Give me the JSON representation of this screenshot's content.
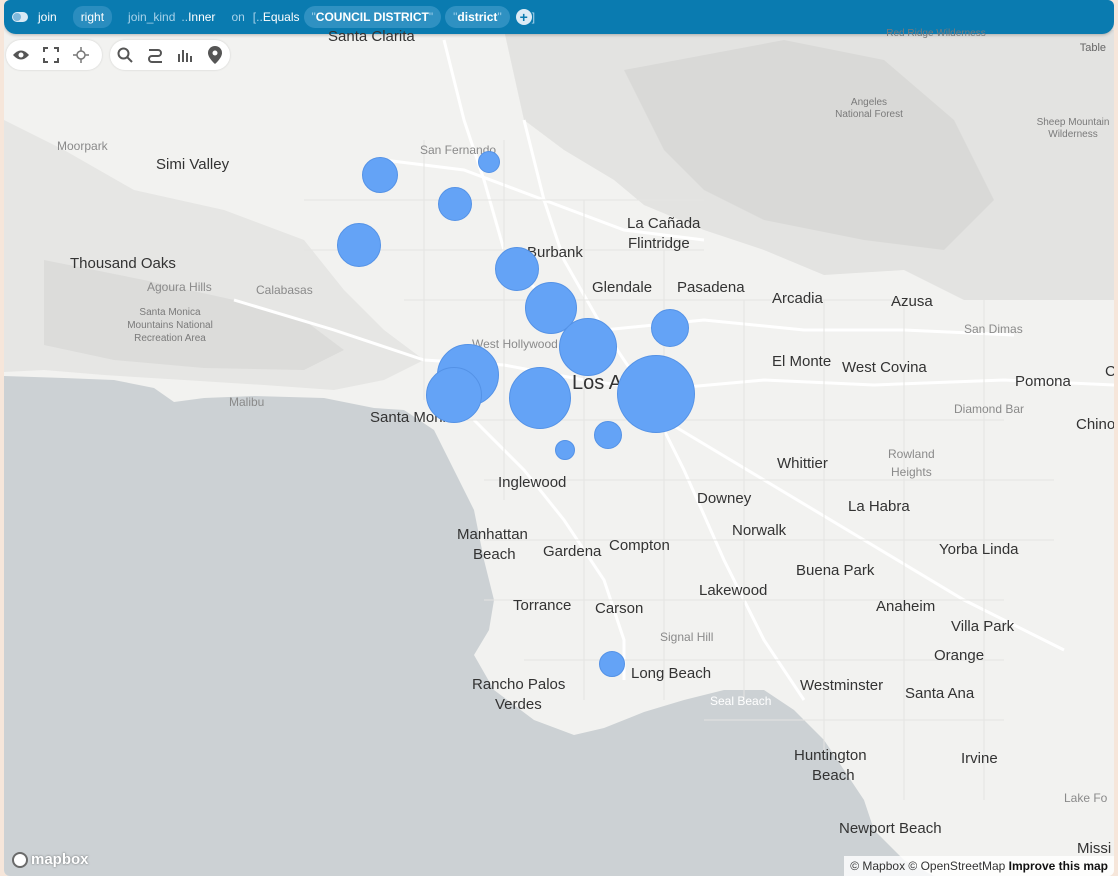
{
  "toolbar": {
    "join_label": "join",
    "right_label": "right",
    "join_kind_label": "join_kind",
    "join_kind_dots": "..",
    "join_kind_value": "Inner",
    "on_label": "on",
    "on_bracket": "[..",
    "equals_label": "Equals",
    "quote": "\"",
    "left_field": "COUNCIL DISTRICT",
    "right_field": "district",
    "close_bracket": "]",
    "add_symbol": "+"
  },
  "map_tools": {
    "group1": [
      "eye-icon",
      "expand-icon",
      "locate-icon"
    ],
    "group2": [
      "search-icon",
      "route-icon",
      "histogram-icon",
      "pin-icon"
    ]
  },
  "table_label": "Table",
  "labels": {
    "santa_clarita": "Santa Clarita",
    "red_ridge_1": "Red Ridge Wilderness",
    "moorpark": "Moorpark",
    "simi_valley": "Simi Valley",
    "san_fernando": "San Fernando",
    "angeles_nf_1": "Angeles",
    "angeles_nf_2": "National Forest",
    "sheep_mtn_1": "Sheep Mountain",
    "sheep_mtn_2": "Wilderness",
    "la_canada_1": "La Cañada",
    "la_canada_2": "Flintridge",
    "burbank": "Burbank",
    "thousand_oaks": "Thousand Oaks",
    "agoura_hills": "Agoura Hills",
    "calabasas": "Calabasas",
    "glendale": "Glendale",
    "pasadena": "Pasadena",
    "arcadia": "Arcadia",
    "azusa": "Azusa",
    "santa_monica_mtn_1": "Santa Monica",
    "santa_monica_mtn_2": "Mountains National",
    "santa_monica_mtn_3": "Recreation Area",
    "san_dimas": "San Dimas",
    "west_hollywood": "West Hollywood",
    "los_angeles": "Los A",
    "el_monte": "El Monte",
    "west_covina": "West Covina",
    "pomona": "Pomona",
    "malibu": "Malibu",
    "santa_monica": "Santa Monica",
    "diamond_bar": "Diamond Bar",
    "chino": "Chino",
    "whittier": "Whittier",
    "rowland_1": "Rowland",
    "rowland_2": "Heights",
    "inglewood": "Inglewood",
    "downey": "Downey",
    "la_habra": "La Habra",
    "norwalk": "Norwalk",
    "manhattan_1": "Manhattan",
    "manhattan_2": "Beach",
    "gardena": "Gardena",
    "compton": "Compton",
    "yorba_linda": "Yorba Linda",
    "buena_park": "Buena Park",
    "lakewood": "Lakewood",
    "torrance": "Torrance",
    "carson": "Carson",
    "anaheim": "Anaheim",
    "signal_hill": "Signal Hill",
    "villa_park": "Villa Park",
    "orange": "Orange",
    "long_beach": "Long Beach",
    "rancho_1": "Rancho Palos",
    "rancho_2": "Verdes",
    "seal_beach": "Seal Beach",
    "westminster": "Westminster",
    "santa_ana": "Santa Ana",
    "huntington_1": "Huntington",
    "huntington_2": "Beach",
    "irvine": "Irvine",
    "lake_forest": "Lake Fo",
    "newport_beach": "Newport Beach",
    "mission": "Missi",
    "c_edge": "C"
  },
  "bubbles_count": 16,
  "logo_text": "mapbox",
  "attribution": {
    "text": "© Mapbox © OpenStreetMap",
    "improve": "Improve this map"
  },
  "colors": {
    "bubble": "#64a3f6",
    "toolbar": "#0a7bb0",
    "water": "#ccd1d4",
    "land": "#f2f2f0"
  }
}
